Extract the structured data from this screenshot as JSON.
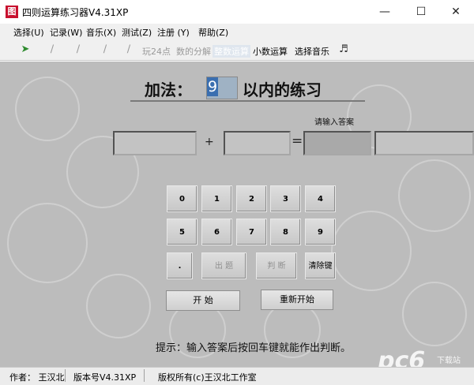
{
  "window": {
    "title": "四则运算练习器V4.31XP",
    "icon_text": "图"
  },
  "menu": [
    "选择(U)",
    "记录(W)",
    "音乐(X)",
    "测试(Z)",
    "注册 (Y)",
    "帮助(Z)"
  ],
  "toolbar": {
    "icons": [
      "play-arrow-icon",
      "add-op-icon",
      "sub-op-icon",
      "mul-op-icon",
      "div-op-icon"
    ],
    "items": [
      "玩24点",
      "数的分解",
      "整数运算",
      "小数运算",
      "选择音乐"
    ]
  },
  "exercise": {
    "heading_prefix": "加法：",
    "range_value": "9",
    "heading_suffix": "以内的练习",
    "plus": "+",
    "equals": "=",
    "answer_label": "请输入答案"
  },
  "keypad": {
    "row1": [
      "0",
      "1",
      "2",
      "3",
      "4"
    ],
    "row2": [
      "5",
      "6",
      "7",
      "8",
      "9"
    ],
    "dot": ".",
    "ask": "出 题",
    "judge": "判 断",
    "clear": "清除键"
  },
  "buttons": {
    "start": "开 始",
    "restart": "重新开始"
  },
  "hint": "提示：输入答案后按回车键就能作出判断。",
  "status": {
    "author": "作者：  王汉北",
    "version": "版本号V4.31XP",
    "copyright": "版权所有(c)王汉北工作室"
  },
  "watermark": {
    "brand": "pc6",
    "sub": "下载站"
  }
}
